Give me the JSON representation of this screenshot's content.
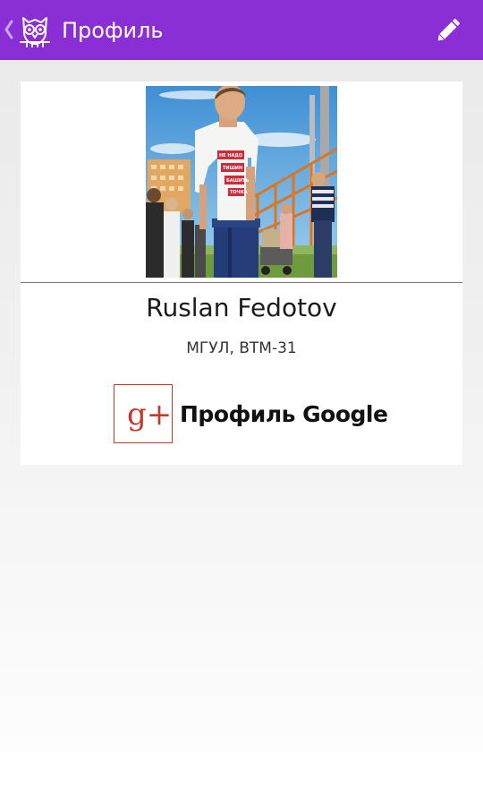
{
  "action_bar": {
    "title": "Профиль",
    "color": "#8a2fd6",
    "icons": [
      "back-chevron-icon",
      "owl-logo-icon",
      "pencil-icon"
    ]
  },
  "profile": {
    "name": "Ruslan Fedotov",
    "group": "МГУЛ, ВТМ-31",
    "photo_tshirt_lines": [
      "НЕ НАДО",
      "ТИШИН",
      "БАШИТЬ",
      "ТОЧКА"
    ]
  },
  "google_link": {
    "label": "Профиль Google",
    "icon": "google-plus-icon",
    "icon_text": "g+"
  }
}
